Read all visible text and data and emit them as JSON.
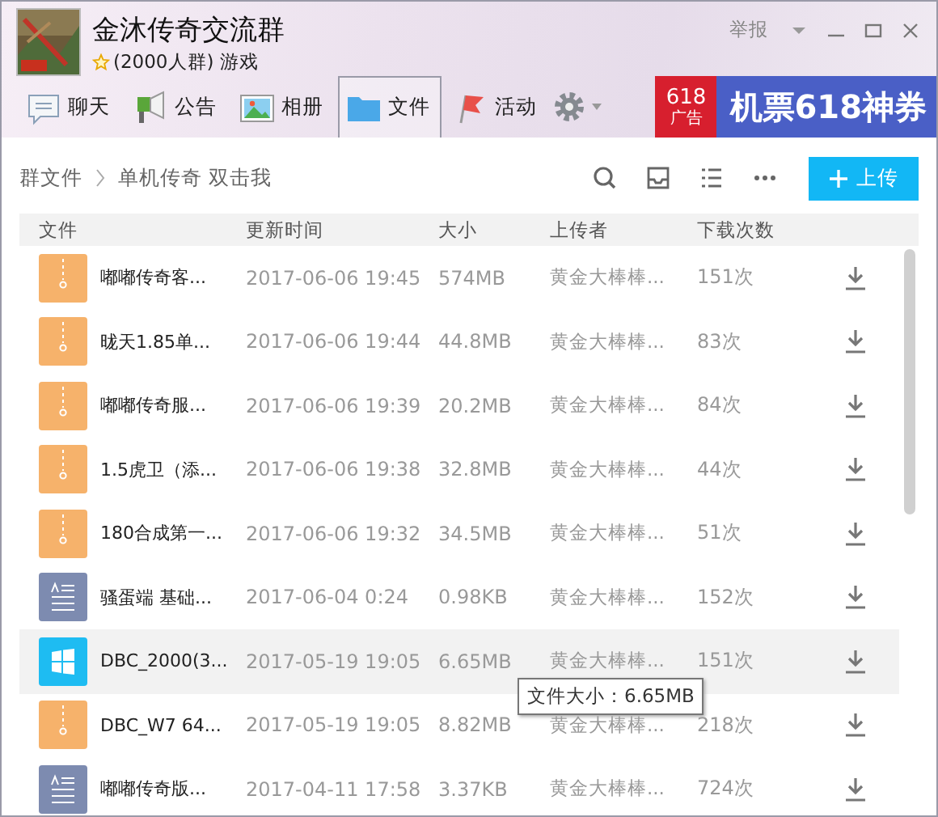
{
  "group": {
    "name": "金沐传奇交流群",
    "meta": "(2000人群) 游戏"
  },
  "window_controls": {
    "report": "举报"
  },
  "tabs": [
    {
      "label": "聊天",
      "kind": "chat",
      "selected": false
    },
    {
      "label": "公告",
      "kind": "notice",
      "selected": false
    },
    {
      "label": "相册",
      "kind": "album",
      "selected": false
    },
    {
      "label": "文件",
      "kind": "file",
      "selected": true
    },
    {
      "label": "活动",
      "kind": "event",
      "selected": false
    }
  ],
  "ad": {
    "logo_number": "618",
    "logo_text": "广告",
    "text": "机票618神券"
  },
  "breadcrumb": [
    {
      "label": "群文件"
    },
    {
      "label": "单机传奇 双击我"
    }
  ],
  "upload_button": {
    "label": "上传"
  },
  "table": {
    "columns": [
      "文件",
      "更新时间",
      "大小",
      "上传者",
      "下载次数"
    ],
    "rows": [
      {
        "kind": "archive",
        "name": "嘟嘟传奇客...",
        "time": "2017-06-06 19:45",
        "size": "574MB",
        "uploader": "黄金大棒棒...",
        "downloads": "151次",
        "highlighted": false
      },
      {
        "kind": "archive",
        "name": "昽天1.85单...",
        "time": "2017-06-06 19:44",
        "size": "44.8MB",
        "uploader": "黄金大棒棒...",
        "downloads": "83次",
        "highlighted": false
      },
      {
        "kind": "archive",
        "name": "嘟嘟传奇服...",
        "time": "2017-06-06 19:39",
        "size": "20.2MB",
        "uploader": "黄金大棒棒...",
        "downloads": "84次",
        "highlighted": false
      },
      {
        "kind": "archive",
        "name": "1.5虎卫（添...",
        "time": "2017-06-06 19:38",
        "size": "32.8MB",
        "uploader": "黄金大棒棒...",
        "downloads": "44次",
        "highlighted": false
      },
      {
        "kind": "archive",
        "name": "180合成第一...",
        "time": "2017-06-06 19:32",
        "size": "34.5MB",
        "uploader": "黄金大棒棒...",
        "downloads": "51次",
        "highlighted": false
      },
      {
        "kind": "text",
        "name": "骚蛋端 基础...",
        "time": "2017-06-04 0:24",
        "size": "0.98KB",
        "uploader": "黄金大棒棒...",
        "downloads": "152次",
        "highlighted": false
      },
      {
        "kind": "exe",
        "name": "DBC_2000(3...",
        "time": "2017-05-19 19:05",
        "size": "6.65MB",
        "uploader": "黄金大棒棒...",
        "downloads": "151次",
        "highlighted": true
      },
      {
        "kind": "archive",
        "name": "DBC_W7 64...",
        "time": "2017-05-19 19:05",
        "size": "8.82MB",
        "uploader": "黄金大棒棒...",
        "downloads": "218次",
        "highlighted": false
      },
      {
        "kind": "text",
        "name": "嘟嘟传奇版...",
        "time": "2017-04-11 17:58",
        "size": "3.37KB",
        "uploader": "黄金大棒棒...",
        "downloads": "724次",
        "highlighted": false
      }
    ]
  },
  "tooltip": {
    "text": "文件大小：6.65MB"
  }
}
